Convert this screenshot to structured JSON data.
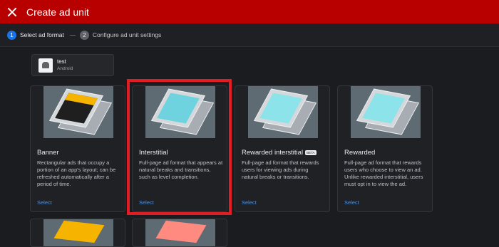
{
  "header": {
    "title": "Create ad unit"
  },
  "steps": [
    {
      "num": "1",
      "label": "Select ad format"
    },
    {
      "num": "2",
      "label": "Configure ad unit settings"
    }
  ],
  "app": {
    "name": "test",
    "platform": "Android"
  },
  "formats": [
    {
      "title": "Banner",
      "desc": "Rectangular ads that occupy a portion of an app's layout; can be refreshed automatically after a period of time.",
      "action": "Select"
    },
    {
      "title": "Interstitial",
      "desc": "Full-page ad format that appears at natural breaks and transitions, such as level completion.",
      "action": "Select"
    },
    {
      "title": "Rewarded interstitial",
      "badge": "BETA",
      "desc": "Full-page ad format that rewards users for viewing ads during natural breaks or transitions.",
      "action": "Select"
    },
    {
      "title": "Rewarded",
      "desc": "Full-page ad format that rewards users who choose to view an ad. Unlike rewarded interstitial, users must opt in to view the ad.",
      "action": "Select"
    }
  ],
  "colors": {
    "topbar": "#b80000",
    "selection": "#e31b23",
    "link": "#4a90e2",
    "banner_accent": "#f6b400",
    "interstitial_accent": "#6fd3df",
    "rewarded_accent": "#8ce3ea",
    "native_accent": "#ff8a80"
  }
}
